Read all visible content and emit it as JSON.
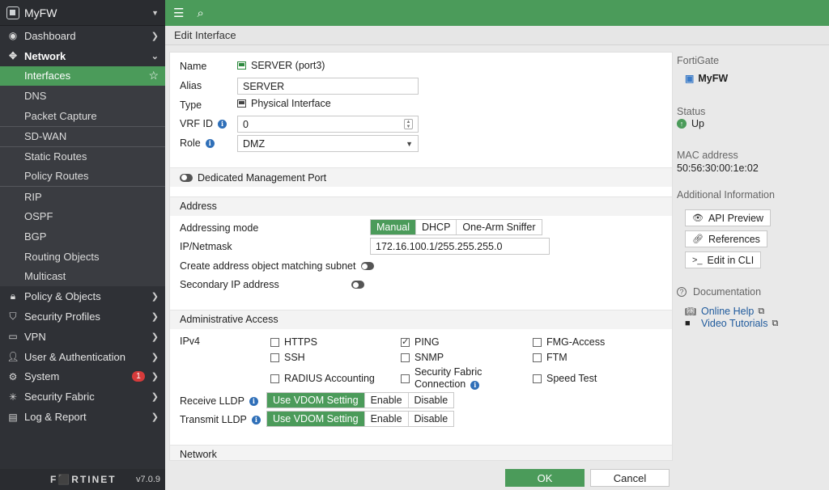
{
  "sidebar": {
    "title": "MyFW",
    "items": [
      {
        "label": "Dashboard"
      },
      {
        "label": "Network"
      },
      {
        "label": "Policy & Objects"
      },
      {
        "label": "Security Profiles"
      },
      {
        "label": "VPN"
      },
      {
        "label": "User & Authentication"
      },
      {
        "label": "System",
        "badge": "1"
      },
      {
        "label": "Security Fabric"
      },
      {
        "label": "Log & Report"
      }
    ],
    "network_sub": [
      {
        "label": "Interfaces"
      },
      {
        "label": "DNS"
      },
      {
        "label": "Packet Capture"
      },
      {
        "label": "SD-WAN"
      },
      {
        "label": "Static Routes"
      },
      {
        "label": "Policy Routes"
      },
      {
        "label": "RIP"
      },
      {
        "label": "OSPF"
      },
      {
        "label": "BGP"
      },
      {
        "label": "Routing Objects"
      },
      {
        "label": "Multicast"
      }
    ],
    "brand": "F⬛RTINET",
    "version": "v7.0.9"
  },
  "page": {
    "breadcrumb": "Edit Interface"
  },
  "form": {
    "name_label": "Name",
    "name_value": "SERVER (port3)",
    "alias_label": "Alias",
    "alias_value": "SERVER",
    "type_label": "Type",
    "type_value": "Physical Interface",
    "vrf_label": "VRF ID",
    "vrf_value": "0",
    "role_label": "Role",
    "role_value": "DMZ",
    "dedicated_mgmt": "Dedicated Management Port",
    "address_section": "Address",
    "addr_mode_label": "Addressing mode",
    "addr_modes": [
      "Manual",
      "DHCP",
      "One-Arm Sniffer"
    ],
    "ipmask_label": "IP/Netmask",
    "ipmask_value": "172.16.100.1/255.255.255.0",
    "create_addr_label": "Create address object matching subnet",
    "secondary_ip_label": "Secondary IP address",
    "admin_section": "Administrative Access",
    "ipv4_label": "IPv4",
    "access": {
      "https": "HTTPS",
      "ping": "PING",
      "fmg": "FMG-Access",
      "ssh": "SSH",
      "snmp": "SNMP",
      "ftm": "FTM",
      "radius": "RADIUS Accounting",
      "sfc_line1": "Security Fabric",
      "sfc_line2": "Connection",
      "speed": "Speed Test"
    },
    "rx_lldp_label": "Receive LLDP",
    "tx_lldp_label": "Transmit LLDP",
    "lldp_opts": [
      "Use VDOM Setting",
      "Enable",
      "Disable"
    ],
    "network_section": "Network"
  },
  "right": {
    "fortigate_label": "FortiGate",
    "fortigate_value": "MyFW",
    "status_label": "Status",
    "status_value": "Up",
    "mac_label": "MAC address",
    "mac_value": "50:56:30:00:1e:02",
    "addl_label": "Additional Information",
    "api_preview": "API Preview",
    "references": "References",
    "edit_cli": "Edit in CLI",
    "doc_label": "Documentation",
    "online_help": "Online Help",
    "video_tutorials": "Video Tutorials"
  },
  "footer": {
    "ok": "OK",
    "cancel": "Cancel"
  },
  "colors": {
    "accent": "#4b9b5a",
    "sidebar_bg": "#2f3136",
    "link": "#1f5a9c",
    "badge": "#d63b3b"
  }
}
